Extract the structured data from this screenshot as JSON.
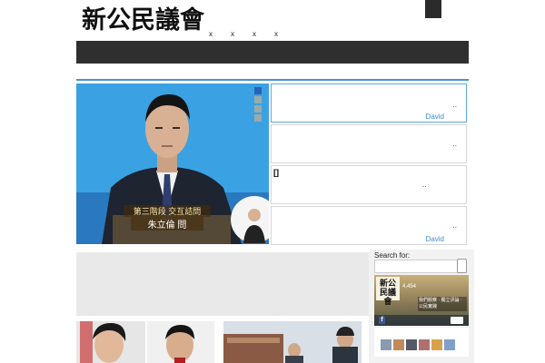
{
  "header": {
    "site_title": "新公民議會",
    "top_links": [
      "x",
      "x",
      "x",
      "x"
    ]
  },
  "slider": {
    "dots": 4,
    "active_dot": 1,
    "caption_line1": "第三階段 交互詰問",
    "caption_line2": "朱立倫 問"
  },
  "side_posts": [
    {
      "dots": "..",
      "author": "David",
      "active": true
    },
    {
      "dots": "..",
      "author": "",
      "active": false
    },
    {
      "bracket": "[]",
      "dots": "..",
      "author": "",
      "active": false
    },
    {
      "dots": "..",
      "author": "David",
      "active": false
    }
  ],
  "sidebar": {
    "search_label": "Search for:",
    "fb_widget": {
      "logo_text": "新公民議會",
      "likes_count": "4,454",
      "caption": "我們觀察 · 獨立評論 · 公民實踐"
    }
  },
  "colors": {
    "accent": "#4a90d9",
    "nav": "#2f2f2f",
    "author_link": "#3b8ed4",
    "ad_gray": "#e9e9e9"
  }
}
